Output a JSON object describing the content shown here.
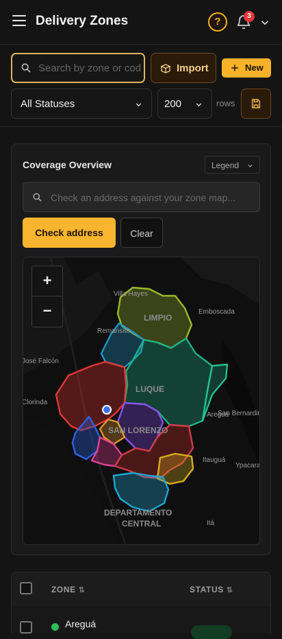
{
  "header": {
    "title": "Delivery Zones",
    "notification_count": "3"
  },
  "toolbar": {
    "search_placeholder": "Search by zone or code",
    "import_label": "Import",
    "new_label": "New",
    "status_filter": "All Statuses",
    "rows_value": "200",
    "rows_label": "rows"
  },
  "coverage": {
    "title": "Coverage Overview",
    "legend_label": "Legend",
    "address_placeholder": "Check an address against your zone map...",
    "check_label": "Check address",
    "clear_label": "Clear"
  },
  "map": {
    "labels": [
      "Villa Hayes",
      "Emboscada",
      "Remansito",
      "LIMPIO",
      "José Falcón",
      "Clorinda",
      "LUQUE",
      "Areguá",
      "San Bernardino",
      "SAN LORENZO",
      "Itauguá",
      "Ypacaraí",
      "DEPARTAMENTO",
      "CENTRAL",
      "Itá"
    ],
    "zone_colors": [
      "#8fa92a",
      "#1f8ab8",
      "#1ea37e",
      "#d6302e",
      "#2a7d3a",
      "#c7a01d",
      "#7a45d6",
      "#d63a8a",
      "#2956c9",
      "#d18a2a",
      "#1f9ec9"
    ]
  },
  "table": {
    "columns": [
      "ZONE",
      "STATUS"
    ],
    "rows": [
      {
        "zone": "Areguá"
      }
    ]
  }
}
